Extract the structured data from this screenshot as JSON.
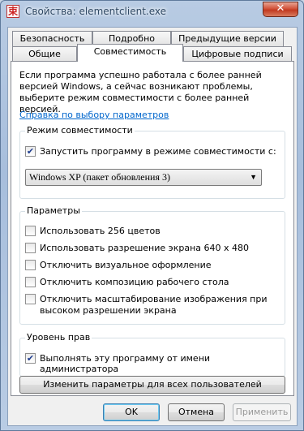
{
  "window": {
    "title": "Свойства: elementclient.exe",
    "close_label": "✕",
    "app_icon_glyph": "束"
  },
  "tabs": {
    "row1": [
      "Безопасность",
      "Подробно",
      "Предыдущие версии"
    ],
    "row2": [
      "Общие",
      "Совместимость",
      "Цифровые подписи"
    ],
    "active": "Совместимость"
  },
  "intro_text": "Если программа успешно работала с более ранней версией Windows, а сейчас возникают проблемы, выберите режим совместимости с более ранней версией.",
  "help_link": "Справка по выбору параметров",
  "compat_mode": {
    "title": "Режим совместимости",
    "checkbox_label": "Запустить программу в режиме совместимости с:",
    "checked": true,
    "selected_os": "Windows XP (пакет обновления 3)"
  },
  "settings": {
    "title": "Параметры",
    "items": [
      {
        "label": "Использовать 256 цветов",
        "checked": false
      },
      {
        "label": "Использовать разрешение экрана 640 x 480",
        "checked": false
      },
      {
        "label": "Отключить визуальное оформление",
        "checked": false
      },
      {
        "label": "Отключить композицию рабочего стола",
        "checked": false
      },
      {
        "label": "Отключить масштабирование изображения при высоком разрешении экрана",
        "checked": false
      }
    ]
  },
  "privilege": {
    "title": "Уровень прав",
    "checkbox_label": "Выполнять эту программу от имени администратора",
    "checked": true
  },
  "change_all_users": "Изменить параметры для всех пользователей",
  "buttons": {
    "ok": "OK",
    "cancel": "Отмена",
    "apply": "Применить"
  },
  "colors": {
    "link": "#0066cc",
    "close_button": "#c9412a"
  }
}
